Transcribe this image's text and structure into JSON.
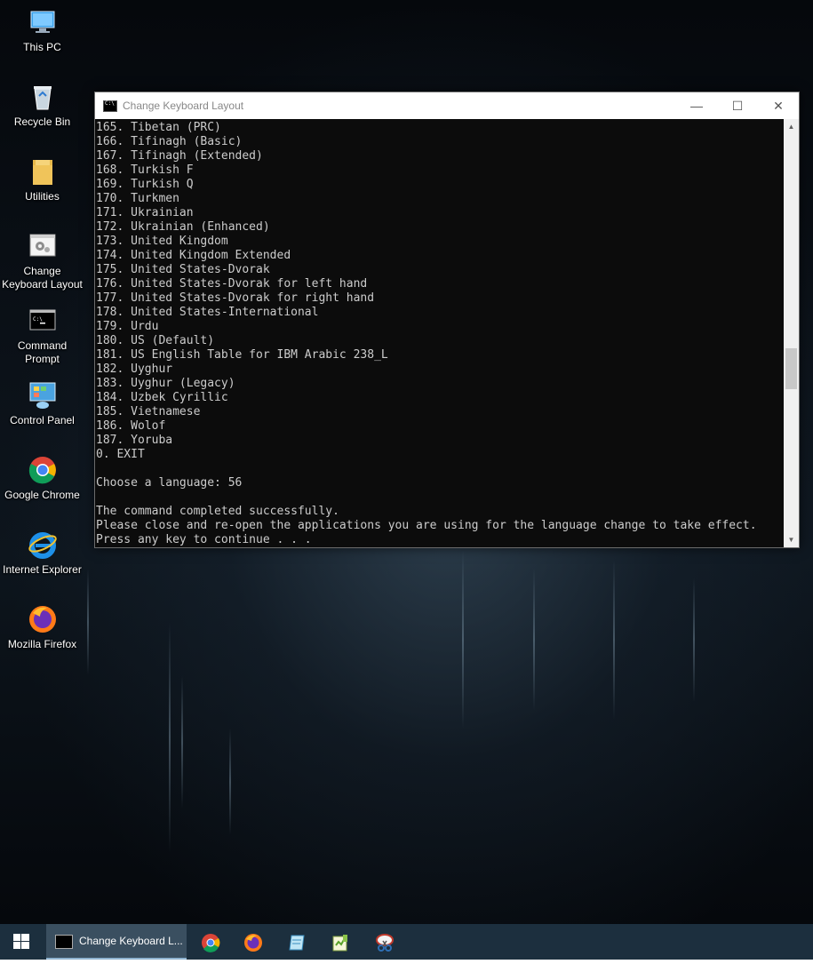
{
  "desktop": {
    "icons": [
      {
        "name": "this-pc",
        "label": "This PC",
        "icon": "computer-icon"
      },
      {
        "name": "recycle-bin",
        "label": "Recycle Bin",
        "icon": "recycle-bin-icon"
      },
      {
        "name": "utilities",
        "label": "Utilities",
        "icon": "folder-icon"
      },
      {
        "name": "change-keyboard-layout",
        "label": "Change Keyboard Layout",
        "icon": "gear-script-icon"
      },
      {
        "name": "command-prompt",
        "label": "Command Prompt",
        "icon": "console-icon"
      },
      {
        "name": "control-panel",
        "label": "Control Panel",
        "icon": "control-panel-icon"
      },
      {
        "name": "google-chrome",
        "label": "Google Chrome",
        "icon": "chrome-icon"
      },
      {
        "name": "internet-explorer",
        "label": "Internet Explorer",
        "icon": "ie-icon"
      },
      {
        "name": "mozilla-firefox",
        "label": "Mozilla Firefox",
        "icon": "firefox-icon"
      }
    ]
  },
  "window": {
    "title": "Change Keyboard Layout",
    "controls": {
      "minimize": "—",
      "maximize": "☐",
      "close": "✕"
    },
    "console_lines": [
      "165. Tibetan (PRC)",
      "166. Tifinagh (Basic)",
      "167. Tifinagh (Extended)",
      "168. Turkish F",
      "169. Turkish Q",
      "170. Turkmen",
      "171. Ukrainian",
      "172. Ukrainian (Enhanced)",
      "173. United Kingdom",
      "174. United Kingdom Extended",
      "175. United States-Dvorak",
      "176. United States-Dvorak for left hand",
      "177. United States-Dvorak for right hand",
      "178. United States-International",
      "179. Urdu",
      "180. US (Default)",
      "181. US English Table for IBM Arabic 238_L",
      "182. Uyghur",
      "183. Uyghur (Legacy)",
      "184. Uzbek Cyrillic",
      "185. Vietnamese",
      "186. Wolof",
      "187. Yoruba",
      "0. EXIT",
      "",
      "Choose a language: 56",
      "",
      "The command completed successfully.",
      "Please close and re-open the applications you are using for the language change to take effect.",
      "Press any key to continue . . ."
    ],
    "scrollbar": {
      "up": "▲",
      "down": "▼",
      "position_fraction": 0.6
    }
  },
  "taskbar": {
    "start_icon": "windows-logo-icon",
    "active_task_label": "Change Keyboard L...",
    "pinned": [
      {
        "name": "chrome",
        "icon": "chrome-icon"
      },
      {
        "name": "firefox",
        "icon": "firefox-icon"
      },
      {
        "name": "notepad",
        "icon": "notepad-icon"
      },
      {
        "name": "notepad-plus",
        "icon": "notepad-plus-icon"
      },
      {
        "name": "snipping-tool",
        "icon": "snipping-tool-icon"
      }
    ]
  },
  "colors": {
    "console_bg": "#0c0c0c",
    "console_fg": "#cccccc",
    "taskbar_bg": "#1c2f3e"
  }
}
